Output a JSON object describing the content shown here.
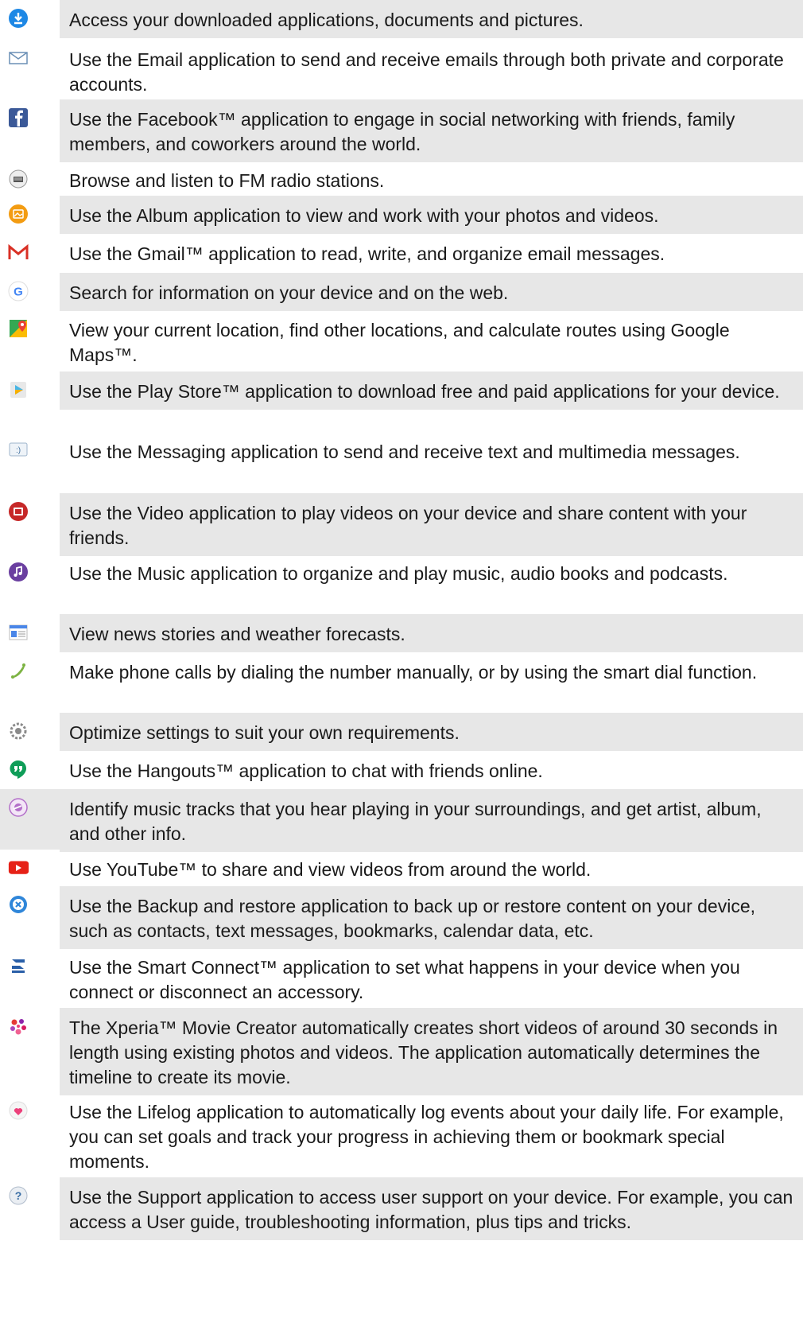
{
  "items": [
    {
      "icon": "download-icon",
      "text": "Access your downloaded applications, documents and pictures."
    },
    {
      "icon": "email-icon",
      "text": "Use the Email application to send and receive emails through both private and corporate accounts."
    },
    {
      "icon": "facebook-icon",
      "text": "Use the Facebook™ application to engage in social networking with friends, family members, and coworkers around the world."
    },
    {
      "icon": "fm-radio-icon",
      "text": "Browse and listen to FM radio stations."
    },
    {
      "icon": "album-icon",
      "text": "Use the Album application to view and work with your photos and videos."
    },
    {
      "icon": "gmail-icon",
      "text": "Use the Gmail™ application to read, write, and organize email messages."
    },
    {
      "icon": "google-icon",
      "text": "Search for information on your device and on the web."
    },
    {
      "icon": "maps-icon",
      "text": "View your current location, find other locations, and calculate routes using Google Maps™."
    },
    {
      "icon": "play-store-icon",
      "text": "Use the Play Store™ application to download free and paid applications for your device."
    },
    {
      "icon": "messaging-icon",
      "text": "Use the Messaging application to send and receive text and multimedia messages."
    },
    {
      "icon": "video-icon",
      "text": "Use the Video application to play videos on your device and share content with your friends."
    },
    {
      "icon": "music-icon",
      "text": "Use the Music application to organize and play music, audio books and podcasts."
    },
    {
      "icon": "news-weather-icon",
      "text": "View news stories and weather forecasts."
    },
    {
      "icon": "phone-icon",
      "text": "Make phone calls by dialing the number manually, or by using the smart dial function."
    },
    {
      "icon": "settings-icon",
      "text": "Optimize settings to suit your own requirements."
    },
    {
      "icon": "hangouts-icon",
      "text": "Use the Hangouts™ application to chat with friends online."
    },
    {
      "icon": "trackid-icon",
      "text": "Identify music tracks that you hear playing in your surroundings, and get artist, album, and other info."
    },
    {
      "icon": "youtube-icon",
      "text": "Use YouTube™ to share and view videos from around the world."
    },
    {
      "icon": "backup-restore-icon",
      "text": "Use the Backup and restore application to back up or restore content on your device, such as contacts, text messages, bookmarks, calendar data, etc."
    },
    {
      "icon": "smart-connect-icon",
      "text": "Use the Smart Connect™ application to set what happens in your device when you connect or disconnect an accessory."
    },
    {
      "icon": "movie-creator-icon",
      "text": "The Xperia™ Movie Creator automatically creates short videos of around 30 seconds in length using existing photos and videos. The application automatically determines the timeline to create its movie."
    },
    {
      "icon": "lifelog-icon",
      "text": "Use the Lifelog application to automatically log events about your daily life. For example, you can set goals and track your progress in achieving them or bookmark special moments."
    },
    {
      "icon": "support-icon",
      "text": "Use the Support application to access user support on your device. For example, you can access a User guide, troubleshooting information, plus tips and tricks."
    }
  ],
  "colors": {
    "shade": "#e7e7e7",
    "text": "#1a1a1a"
  }
}
